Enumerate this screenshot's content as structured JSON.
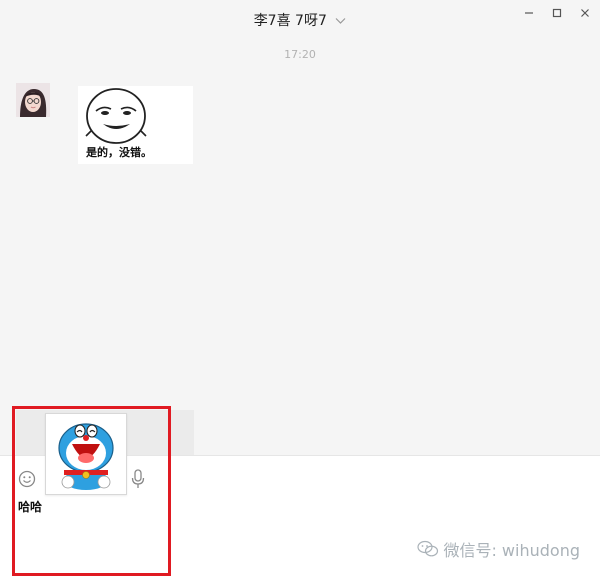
{
  "window": {
    "title": "李7喜 7呀7",
    "controls": {
      "minimize": "–",
      "maximize": "□",
      "close": "×"
    }
  },
  "chat": {
    "timestamp": "17:20",
    "messages": [
      {
        "sender": "contact",
        "type": "sticker",
        "sticker_name": "rage-face-meme",
        "caption": "是的，没错。"
      }
    ]
  },
  "input": {
    "tools": [
      "emoji-icon",
      "microphone-icon"
    ],
    "sticker_preview": "doraemon-laughing",
    "draft_text": "哈哈"
  },
  "watermark": {
    "text": "微信号: wihudong"
  },
  "colors": {
    "highlight": "#e01a22",
    "background": "#f5f5f5"
  }
}
